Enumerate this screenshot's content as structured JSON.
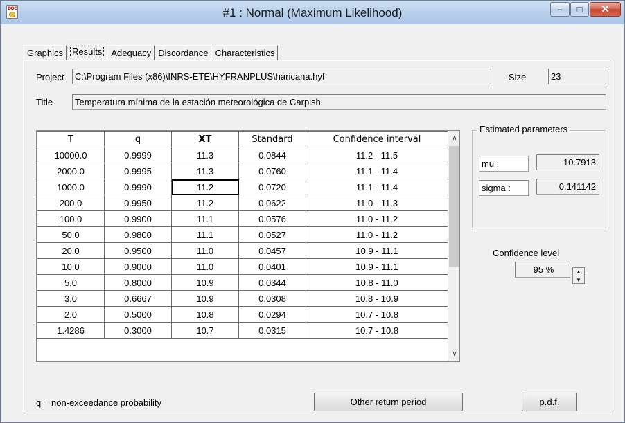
{
  "window": {
    "title": "#1 : Normal (Maximum Likelihood)"
  },
  "icons": {
    "app": "doc-app-icon",
    "minimize": "minimize-icon",
    "maximize": "maximize-icon",
    "close": "close-icon"
  },
  "tabs": [
    {
      "label": "Graphics",
      "active": false
    },
    {
      "label": "Results",
      "active": true
    },
    {
      "label": "Adequacy",
      "active": false
    },
    {
      "label": "Discordance",
      "active": false
    },
    {
      "label": "Characteristics",
      "active": false
    }
  ],
  "project": {
    "label": "Project",
    "value": "C:\\Program Files (x86)\\INRS-ETE\\HYFRANPLUS\\haricana.hyf"
  },
  "size": {
    "label": "Size",
    "value": "23"
  },
  "title_field": {
    "label": "Title",
    "value": "Temperatura mínima de la estación meteorológica de Carpish"
  },
  "results_table": {
    "columns": [
      "T",
      "q",
      "XT",
      "Standard",
      "Confidence interval"
    ],
    "rows": [
      [
        "10000.0",
        "0.9999",
        "11.3",
        "0.0844",
        "11.2 - 11.5"
      ],
      [
        "2000.0",
        "0.9995",
        "11.3",
        "0.0760",
        "11.1 - 11.4"
      ],
      [
        "1000.0",
        "0.9990",
        "11.2",
        "0.0720",
        "11.1 - 11.4"
      ],
      [
        "200.0",
        "0.9950",
        "11.2",
        "0.0622",
        "11.0 - 11.3"
      ],
      [
        "100.0",
        "0.9900",
        "11.1",
        "0.0576",
        "11.0 - 11.2"
      ],
      [
        "50.0",
        "0.9800",
        "11.1",
        "0.0527",
        "11.0 - 11.2"
      ],
      [
        "20.0",
        "0.9500",
        "11.0",
        "0.0457",
        "10.9 - 11.1"
      ],
      [
        "10.0",
        "0.9000",
        "11.0",
        "0.0401",
        "10.9 - 11.1"
      ],
      [
        "5.0",
        "0.8000",
        "10.9",
        "0.0344",
        "10.8 - 11.0"
      ],
      [
        "3.0",
        "0.6667",
        "10.9",
        "0.0308",
        "10.8 - 10.9"
      ],
      [
        "2.0",
        "0.5000",
        "10.8",
        "0.0294",
        "10.7 - 10.8"
      ],
      [
        "1.4286",
        "0.3000",
        "10.7",
        "0.0315",
        "10.7 - 10.8"
      ]
    ]
  },
  "parameters": {
    "title": "Estimated parameters",
    "mu_label": "mu :",
    "mu_value": "10.7913",
    "sigma_label": "sigma :",
    "sigma_value": "0.141142"
  },
  "confidence": {
    "label": "Confidence level",
    "value": "95 %"
  },
  "footer": {
    "note": "q = non-exceedance probability",
    "other_return_button": "Other return period",
    "pdf_button": "p.d.f."
  }
}
